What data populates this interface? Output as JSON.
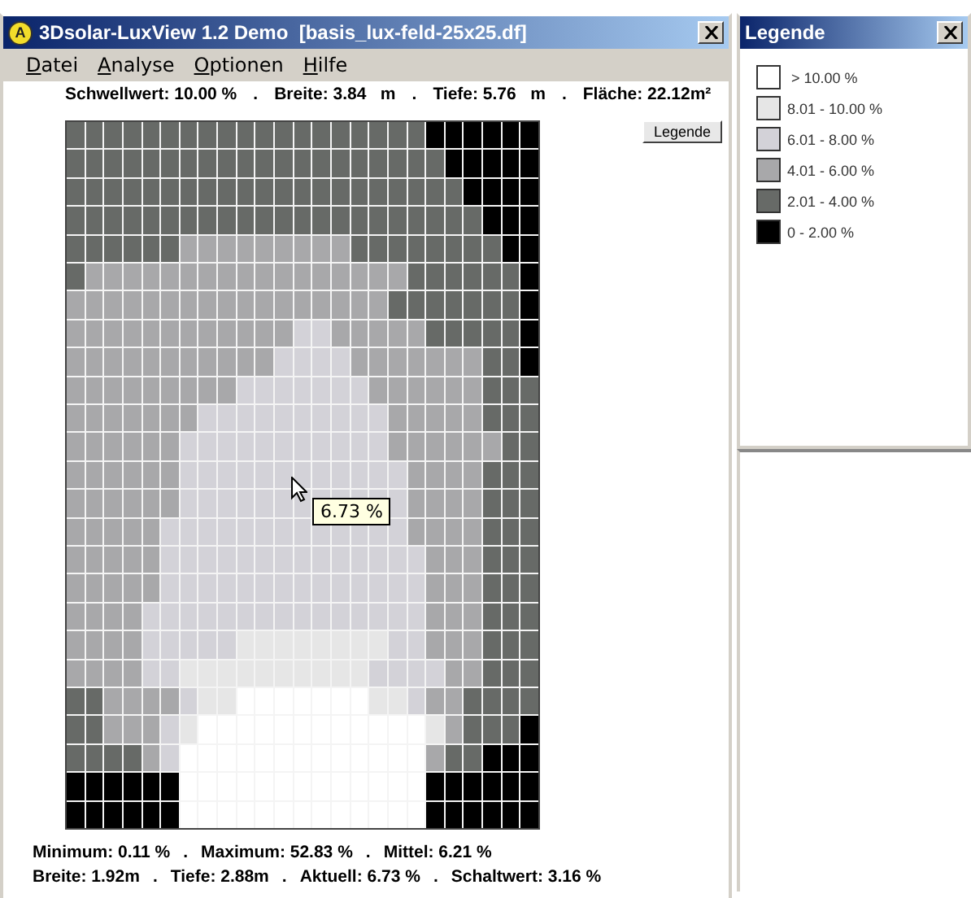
{
  "main_window": {
    "icon_letter": "A",
    "title": "3Dsolar-LuxView 1.2 Demo  [basis_lux-feld-25x25.df]"
  },
  "menu": [
    "Datei",
    "Analyse",
    "Optionen",
    "Hilfe"
  ],
  "header_info": [
    "Schwellwert: 10.00 %",
    "Breite: 3.84   m",
    "Tiefe: 5.76   m",
    "Fläche: 22.12m²"
  ],
  "header_separator": ".",
  "legend_button": "Legende",
  "heatmap": {
    "rows": [
      {
        "cells": [
          {
            "color": "#676a67"
          },
          {
            "color": "#676a67"
          },
          {
            "color": "#676a67"
          },
          {
            "color": "#676a67"
          },
          {
            "color": "#676a67"
          },
          {
            "color": "#676a67"
          },
          {
            "color": "#676a67"
          },
          {
            "color": "#676a67"
          },
          {
            "color": "#676a67"
          },
          {
            "color": "#676a67"
          },
          {
            "color": "#676a67"
          },
          {
            "color": "#676a67"
          },
          {
            "color": "#676a67"
          },
          {
            "color": "#676a67"
          },
          {
            "color": "#676a67"
          },
          {
            "color": "#676a67"
          },
          {
            "color": "#676a67"
          },
          {
            "color": "#676a67"
          },
          {
            "color": "#676a67"
          },
          {
            "color": "#000000"
          },
          {
            "color": "#000000"
          },
          {
            "color": "#000000"
          },
          {
            "color": "#000000"
          },
          {
            "color": "#000000"
          },
          {
            "color": "#000000"
          }
        ]
      },
      {
        "cells": [
          {
            "color": "#676a67"
          },
          {
            "color": "#676a67"
          },
          {
            "color": "#676a67"
          },
          {
            "color": "#676a67"
          },
          {
            "color": "#676a67"
          },
          {
            "color": "#676a67"
          },
          {
            "color": "#676a67"
          },
          {
            "color": "#676a67"
          },
          {
            "color": "#676a67"
          },
          {
            "color": "#676a67"
          },
          {
            "color": "#676a67"
          },
          {
            "color": "#676a67"
          },
          {
            "color": "#676a67"
          },
          {
            "color": "#676a67"
          },
          {
            "color": "#676a67"
          },
          {
            "color": "#676a67"
          },
          {
            "color": "#676a67"
          },
          {
            "color": "#676a67"
          },
          {
            "color": "#676a67"
          },
          {
            "color": "#676a67"
          },
          {
            "color": "#000000"
          },
          {
            "color": "#000000"
          },
          {
            "color": "#000000"
          },
          {
            "color": "#000000"
          },
          {
            "color": "#000000"
          }
        ]
      },
      {
        "cells": [
          {
            "color": "#676a67"
          },
          {
            "color": "#676a67"
          },
          {
            "color": "#676a67"
          },
          {
            "color": "#676a67"
          },
          {
            "color": "#676a67"
          },
          {
            "color": "#676a67"
          },
          {
            "color": "#676a67"
          },
          {
            "color": "#676a67"
          },
          {
            "color": "#676a67"
          },
          {
            "color": "#676a67"
          },
          {
            "color": "#676a67"
          },
          {
            "color": "#676a67"
          },
          {
            "color": "#676a67"
          },
          {
            "color": "#676a67"
          },
          {
            "color": "#676a67"
          },
          {
            "color": "#676a67"
          },
          {
            "color": "#676a67"
          },
          {
            "color": "#676a67"
          },
          {
            "color": "#676a67"
          },
          {
            "color": "#676a67"
          },
          {
            "color": "#676a67"
          },
          {
            "color": "#000000"
          },
          {
            "color": "#000000"
          },
          {
            "color": "#000000"
          },
          {
            "color": "#000000"
          }
        ]
      },
      {
        "cells": [
          {
            "color": "#676a67"
          },
          {
            "color": "#676a67"
          },
          {
            "color": "#676a67"
          },
          {
            "color": "#676a67"
          },
          {
            "color": "#676a67"
          },
          {
            "color": "#676a67"
          },
          {
            "color": "#676a67"
          },
          {
            "color": "#676a67"
          },
          {
            "color": "#676a67"
          },
          {
            "color": "#676a67"
          },
          {
            "color": "#676a67"
          },
          {
            "color": "#676a67"
          },
          {
            "color": "#676a67"
          },
          {
            "color": "#676a67"
          },
          {
            "color": "#676a67"
          },
          {
            "color": "#676a67"
          },
          {
            "color": "#676a67"
          },
          {
            "color": "#676a67"
          },
          {
            "color": "#676a67"
          },
          {
            "color": "#676a67"
          },
          {
            "color": "#676a67"
          },
          {
            "color": "#676a67"
          },
          {
            "color": "#000000"
          },
          {
            "color": "#000000"
          },
          {
            "color": "#000000"
          }
        ]
      },
      {
        "cells": [
          {
            "color": "#676a67"
          },
          {
            "color": "#676a67"
          },
          {
            "color": "#676a67"
          },
          {
            "color": "#676a67"
          },
          {
            "color": "#676a67"
          },
          {
            "color": "#676a67"
          },
          {
            "color": "#a8a8aa"
          },
          {
            "color": "#a8a8aa"
          },
          {
            "color": "#a8a8aa"
          },
          {
            "color": "#a8a8aa"
          },
          {
            "color": "#a8a8aa"
          },
          {
            "color": "#a8a8aa"
          },
          {
            "color": "#a8a8aa"
          },
          {
            "color": "#a8a8aa"
          },
          {
            "color": "#a8a8aa"
          },
          {
            "color": "#676a67"
          },
          {
            "color": "#676a67"
          },
          {
            "color": "#676a67"
          },
          {
            "color": "#676a67"
          },
          {
            "color": "#676a67"
          },
          {
            "color": "#676a67"
          },
          {
            "color": "#676a67"
          },
          {
            "color": "#676a67"
          },
          {
            "color": "#000000"
          },
          {
            "color": "#000000"
          }
        ]
      },
      {
        "cells": [
          {
            "color": "#676a67"
          },
          {
            "color": "#a8a8aa"
          },
          {
            "color": "#a8a8aa"
          },
          {
            "color": "#a8a8aa"
          },
          {
            "color": "#a8a8aa"
          },
          {
            "color": "#a8a8aa"
          },
          {
            "color": "#a8a8aa"
          },
          {
            "color": "#a8a8aa"
          },
          {
            "color": "#a8a8aa"
          },
          {
            "color": "#a8a8aa"
          },
          {
            "color": "#a8a8aa"
          },
          {
            "color": "#a8a8aa"
          },
          {
            "color": "#a8a8aa"
          },
          {
            "color": "#a8a8aa"
          },
          {
            "color": "#a8a8aa"
          },
          {
            "color": "#a8a8aa"
          },
          {
            "color": "#a8a8aa"
          },
          {
            "color": "#a8a8aa"
          },
          {
            "color": "#676a67"
          },
          {
            "color": "#676a67"
          },
          {
            "color": "#676a67"
          },
          {
            "color": "#676a67"
          },
          {
            "color": "#676a67"
          },
          {
            "color": "#676a67"
          },
          {
            "color": "#000000"
          }
        ]
      },
      {
        "cells": [
          {
            "color": "#a8a8aa"
          },
          {
            "color": "#a8a8aa"
          },
          {
            "color": "#a8a8aa"
          },
          {
            "color": "#a8a8aa"
          },
          {
            "color": "#a8a8aa"
          },
          {
            "color": "#a8a8aa"
          },
          {
            "color": "#a8a8aa"
          },
          {
            "color": "#a8a8aa"
          },
          {
            "color": "#a8a8aa"
          },
          {
            "color": "#a8a8aa"
          },
          {
            "color": "#a8a8aa"
          },
          {
            "color": "#a8a8aa"
          },
          {
            "color": "#a8a8aa"
          },
          {
            "color": "#a8a8aa"
          },
          {
            "color": "#a8a8aa"
          },
          {
            "color": "#a8a8aa"
          },
          {
            "color": "#a8a8aa"
          },
          {
            "color": "#676a67"
          },
          {
            "color": "#676a67"
          },
          {
            "color": "#676a67"
          },
          {
            "color": "#676a67"
          },
          {
            "color": "#676a67"
          },
          {
            "color": "#676a67"
          },
          {
            "color": "#676a67"
          },
          {
            "color": "#000000"
          }
        ]
      },
      {
        "cells": [
          {
            "color": "#a8a8aa"
          },
          {
            "color": "#a8a8aa"
          },
          {
            "color": "#a8a8aa"
          },
          {
            "color": "#a8a8aa"
          },
          {
            "color": "#a8a8aa"
          },
          {
            "color": "#a8a8aa"
          },
          {
            "color": "#a8a8aa"
          },
          {
            "color": "#a8a8aa"
          },
          {
            "color": "#a8a8aa"
          },
          {
            "color": "#a8a8aa"
          },
          {
            "color": "#a8a8aa"
          },
          {
            "color": "#a8a8aa"
          },
          {
            "color": "#d3d2d8"
          },
          {
            "color": "#d3d2d8"
          },
          {
            "color": "#a8a8aa"
          },
          {
            "color": "#a8a8aa"
          },
          {
            "color": "#a8a8aa"
          },
          {
            "color": "#a8a8aa"
          },
          {
            "color": "#a8a8aa"
          },
          {
            "color": "#676a67"
          },
          {
            "color": "#676a67"
          },
          {
            "color": "#676a67"
          },
          {
            "color": "#676a67"
          },
          {
            "color": "#676a67"
          },
          {
            "color": "#000000"
          }
        ]
      },
      {
        "cells": [
          {
            "color": "#a8a8aa"
          },
          {
            "color": "#a8a8aa"
          },
          {
            "color": "#a8a8aa"
          },
          {
            "color": "#a8a8aa"
          },
          {
            "color": "#a8a8aa"
          },
          {
            "color": "#a8a8aa"
          },
          {
            "color": "#a8a8aa"
          },
          {
            "color": "#a8a8aa"
          },
          {
            "color": "#a8a8aa"
          },
          {
            "color": "#a8a8aa"
          },
          {
            "color": "#a8a8aa"
          },
          {
            "color": "#d3d2d8"
          },
          {
            "color": "#d3d2d8"
          },
          {
            "color": "#d3d2d8"
          },
          {
            "color": "#d3d2d8"
          },
          {
            "color": "#a8a8aa"
          },
          {
            "color": "#a8a8aa"
          },
          {
            "color": "#a8a8aa"
          },
          {
            "color": "#a8a8aa"
          },
          {
            "color": "#a8a8aa"
          },
          {
            "color": "#a8a8aa"
          },
          {
            "color": "#a8a8aa"
          },
          {
            "color": "#676a67"
          },
          {
            "color": "#676a67"
          },
          {
            "color": "#000000"
          }
        ]
      },
      {
        "cells": [
          {
            "color": "#a8a8aa"
          },
          {
            "color": "#a8a8aa"
          },
          {
            "color": "#a8a8aa"
          },
          {
            "color": "#a8a8aa"
          },
          {
            "color": "#a8a8aa"
          },
          {
            "color": "#a8a8aa"
          },
          {
            "color": "#a8a8aa"
          },
          {
            "color": "#a8a8aa"
          },
          {
            "color": "#a8a8aa"
          },
          {
            "color": "#d3d2d8"
          },
          {
            "color": "#d3d2d8"
          },
          {
            "color": "#d3d2d8"
          },
          {
            "color": "#d3d2d8"
          },
          {
            "color": "#d3d2d8"
          },
          {
            "color": "#d3d2d8"
          },
          {
            "color": "#d3d2d8"
          },
          {
            "color": "#a8a8aa"
          },
          {
            "color": "#a8a8aa"
          },
          {
            "color": "#a8a8aa"
          },
          {
            "color": "#a8a8aa"
          },
          {
            "color": "#a8a8aa"
          },
          {
            "color": "#a8a8aa"
          },
          {
            "color": "#676a67"
          },
          {
            "color": "#676a67"
          },
          {
            "color": "#676a67"
          }
        ]
      },
      {
        "cells": [
          {
            "color": "#a8a8aa"
          },
          {
            "color": "#a8a8aa"
          },
          {
            "color": "#a8a8aa"
          },
          {
            "color": "#a8a8aa"
          },
          {
            "color": "#a8a8aa"
          },
          {
            "color": "#a8a8aa"
          },
          {
            "color": "#a8a8aa"
          },
          {
            "color": "#d3d2d8"
          },
          {
            "color": "#d3d2d8"
          },
          {
            "color": "#d3d2d8"
          },
          {
            "color": "#d3d2d8"
          },
          {
            "color": "#d3d2d8"
          },
          {
            "color": "#d3d2d8"
          },
          {
            "color": "#d3d2d8"
          },
          {
            "color": "#d3d2d8"
          },
          {
            "color": "#d3d2d8"
          },
          {
            "color": "#d3d2d8"
          },
          {
            "color": "#a8a8aa"
          },
          {
            "color": "#a8a8aa"
          },
          {
            "color": "#a8a8aa"
          },
          {
            "color": "#a8a8aa"
          },
          {
            "color": "#a8a8aa"
          },
          {
            "color": "#676a67"
          },
          {
            "color": "#676a67"
          },
          {
            "color": "#676a67"
          }
        ]
      },
      {
        "cells": [
          {
            "color": "#a8a8aa"
          },
          {
            "color": "#a8a8aa"
          },
          {
            "color": "#a8a8aa"
          },
          {
            "color": "#a8a8aa"
          },
          {
            "color": "#a8a8aa"
          },
          {
            "color": "#a8a8aa"
          },
          {
            "color": "#d3d2d8"
          },
          {
            "color": "#d3d2d8"
          },
          {
            "color": "#d3d2d8"
          },
          {
            "color": "#d3d2d8"
          },
          {
            "color": "#d3d2d8"
          },
          {
            "color": "#d3d2d8"
          },
          {
            "color": "#d3d2d8"
          },
          {
            "color": "#d3d2d8"
          },
          {
            "color": "#d3d2d8"
          },
          {
            "color": "#d3d2d8"
          },
          {
            "color": "#d3d2d8"
          },
          {
            "color": "#a8a8aa"
          },
          {
            "color": "#a8a8aa"
          },
          {
            "color": "#a8a8aa"
          },
          {
            "color": "#a8a8aa"
          },
          {
            "color": "#a8a8aa"
          },
          {
            "color": "#a8a8aa"
          },
          {
            "color": "#676a67"
          },
          {
            "color": "#676a67"
          }
        ]
      },
      {
        "cells": [
          {
            "color": "#a8a8aa"
          },
          {
            "color": "#a8a8aa"
          },
          {
            "color": "#a8a8aa"
          },
          {
            "color": "#a8a8aa"
          },
          {
            "color": "#a8a8aa"
          },
          {
            "color": "#a8a8aa"
          },
          {
            "color": "#d3d2d8"
          },
          {
            "color": "#d3d2d8"
          },
          {
            "color": "#d3d2d8"
          },
          {
            "color": "#d3d2d8"
          },
          {
            "color": "#d3d2d8"
          },
          {
            "color": "#d3d2d8"
          },
          {
            "color": "#d3d2d8"
          },
          {
            "color": "#d3d2d8"
          },
          {
            "color": "#d3d2d8"
          },
          {
            "color": "#d3d2d8"
          },
          {
            "color": "#d3d2d8"
          },
          {
            "color": "#d3d2d8"
          },
          {
            "color": "#a8a8aa"
          },
          {
            "color": "#a8a8aa"
          },
          {
            "color": "#a8a8aa"
          },
          {
            "color": "#a8a8aa"
          },
          {
            "color": "#676a67"
          },
          {
            "color": "#676a67"
          },
          {
            "color": "#676a67"
          }
        ]
      },
      {
        "cells": [
          {
            "color": "#a8a8aa"
          },
          {
            "color": "#a8a8aa"
          },
          {
            "color": "#a8a8aa"
          },
          {
            "color": "#a8a8aa"
          },
          {
            "color": "#a8a8aa"
          },
          {
            "color": "#a8a8aa"
          },
          {
            "color": "#d3d2d8"
          },
          {
            "color": "#d3d2d8"
          },
          {
            "color": "#d3d2d8"
          },
          {
            "color": "#d3d2d8"
          },
          {
            "color": "#d3d2d8"
          },
          {
            "color": "#d3d2d8"
          },
          {
            "color": "#d3d2d8"
          },
          {
            "color": "#d3d2d8"
          },
          {
            "color": "#d3d2d8"
          },
          {
            "color": "#d3d2d8"
          },
          {
            "color": "#d3d2d8"
          },
          {
            "color": "#d3d2d8"
          },
          {
            "color": "#a8a8aa"
          },
          {
            "color": "#a8a8aa"
          },
          {
            "color": "#a8a8aa"
          },
          {
            "color": "#a8a8aa"
          },
          {
            "color": "#676a67"
          },
          {
            "color": "#676a67"
          },
          {
            "color": "#676a67"
          }
        ]
      },
      {
        "cells": [
          {
            "color": "#a8a8aa"
          },
          {
            "color": "#a8a8aa"
          },
          {
            "color": "#a8a8aa"
          },
          {
            "color": "#a8a8aa"
          },
          {
            "color": "#a8a8aa"
          },
          {
            "color": "#d3d2d8"
          },
          {
            "color": "#d3d2d8"
          },
          {
            "color": "#d3d2d8"
          },
          {
            "color": "#d3d2d8"
          },
          {
            "color": "#d3d2d8"
          },
          {
            "color": "#d3d2d8"
          },
          {
            "color": "#d3d2d8"
          },
          {
            "color": "#d3d2d8"
          },
          {
            "color": "#d3d2d8"
          },
          {
            "color": "#d3d2d8"
          },
          {
            "color": "#d3d2d8"
          },
          {
            "color": "#d3d2d8"
          },
          {
            "color": "#d3d2d8"
          },
          {
            "color": "#a8a8aa"
          },
          {
            "color": "#a8a8aa"
          },
          {
            "color": "#a8a8aa"
          },
          {
            "color": "#a8a8aa"
          },
          {
            "color": "#676a67"
          },
          {
            "color": "#676a67"
          },
          {
            "color": "#676a67"
          }
        ]
      },
      {
        "cells": [
          {
            "color": "#a8a8aa"
          },
          {
            "color": "#a8a8aa"
          },
          {
            "color": "#a8a8aa"
          },
          {
            "color": "#a8a8aa"
          },
          {
            "color": "#a8a8aa"
          },
          {
            "color": "#d3d2d8"
          },
          {
            "color": "#d3d2d8"
          },
          {
            "color": "#d3d2d8"
          },
          {
            "color": "#d3d2d8"
          },
          {
            "color": "#d3d2d8"
          },
          {
            "color": "#d3d2d8"
          },
          {
            "color": "#d3d2d8"
          },
          {
            "color": "#d3d2d8"
          },
          {
            "color": "#d3d2d8"
          },
          {
            "color": "#d3d2d8"
          },
          {
            "color": "#d3d2d8"
          },
          {
            "color": "#d3d2d8"
          },
          {
            "color": "#d3d2d8"
          },
          {
            "color": "#d3d2d8"
          },
          {
            "color": "#a8a8aa"
          },
          {
            "color": "#a8a8aa"
          },
          {
            "color": "#a8a8aa"
          },
          {
            "color": "#676a67"
          },
          {
            "color": "#676a67"
          },
          {
            "color": "#676a67"
          }
        ]
      },
      {
        "cells": [
          {
            "color": "#a8a8aa"
          },
          {
            "color": "#a8a8aa"
          },
          {
            "color": "#a8a8aa"
          },
          {
            "color": "#a8a8aa"
          },
          {
            "color": "#a8a8aa"
          },
          {
            "color": "#d3d2d8"
          },
          {
            "color": "#d3d2d8"
          },
          {
            "color": "#d3d2d8"
          },
          {
            "color": "#d3d2d8"
          },
          {
            "color": "#d3d2d8"
          },
          {
            "color": "#d3d2d8"
          },
          {
            "color": "#d3d2d8"
          },
          {
            "color": "#d3d2d8"
          },
          {
            "color": "#d3d2d8"
          },
          {
            "color": "#d3d2d8"
          },
          {
            "color": "#d3d2d8"
          },
          {
            "color": "#d3d2d8"
          },
          {
            "color": "#d3d2d8"
          },
          {
            "color": "#d3d2d8"
          },
          {
            "color": "#a8a8aa"
          },
          {
            "color": "#a8a8aa"
          },
          {
            "color": "#a8a8aa"
          },
          {
            "color": "#676a67"
          },
          {
            "color": "#676a67"
          },
          {
            "color": "#676a67"
          }
        ]
      },
      {
        "cells": [
          {
            "color": "#a8a8aa"
          },
          {
            "color": "#a8a8aa"
          },
          {
            "color": "#a8a8aa"
          },
          {
            "color": "#a8a8aa"
          },
          {
            "color": "#d3d2d8"
          },
          {
            "color": "#d3d2d8"
          },
          {
            "color": "#d3d2d8"
          },
          {
            "color": "#d3d2d8"
          },
          {
            "color": "#d3d2d8"
          },
          {
            "color": "#d3d2d8"
          },
          {
            "color": "#d3d2d8"
          },
          {
            "color": "#d3d2d8"
          },
          {
            "color": "#d3d2d8"
          },
          {
            "color": "#d3d2d8"
          },
          {
            "color": "#d3d2d8"
          },
          {
            "color": "#d3d2d8"
          },
          {
            "color": "#d3d2d8"
          },
          {
            "color": "#d3d2d8"
          },
          {
            "color": "#d3d2d8"
          },
          {
            "color": "#a8a8aa"
          },
          {
            "color": "#a8a8aa"
          },
          {
            "color": "#a8a8aa"
          },
          {
            "color": "#676a67"
          },
          {
            "color": "#676a67"
          },
          {
            "color": "#676a67"
          }
        ]
      },
      {
        "cells": [
          {
            "color": "#a8a8aa"
          },
          {
            "color": "#a8a8aa"
          },
          {
            "color": "#a8a8aa"
          },
          {
            "color": "#a8a8aa"
          },
          {
            "color": "#d3d2d8"
          },
          {
            "color": "#d3d2d8"
          },
          {
            "color": "#d3d2d8"
          },
          {
            "color": "#d3d2d8"
          },
          {
            "color": "#d3d2d8"
          },
          {
            "color": "#e6e6e6"
          },
          {
            "color": "#e6e6e6"
          },
          {
            "color": "#e6e6e6"
          },
          {
            "color": "#e6e6e6"
          },
          {
            "color": "#e6e6e6"
          },
          {
            "color": "#e6e6e6"
          },
          {
            "color": "#e6e6e6"
          },
          {
            "color": "#e6e6e6"
          },
          {
            "color": "#d3d2d8"
          },
          {
            "color": "#d3d2d8"
          },
          {
            "color": "#a8a8aa"
          },
          {
            "color": "#a8a8aa"
          },
          {
            "color": "#a8a8aa"
          },
          {
            "color": "#676a67"
          },
          {
            "color": "#676a67"
          },
          {
            "color": "#676a67"
          }
        ]
      },
      {
        "cells": [
          {
            "color": "#a8a8aa"
          },
          {
            "color": "#a8a8aa"
          },
          {
            "color": "#a8a8aa"
          },
          {
            "color": "#a8a8aa"
          },
          {
            "color": "#d3d2d8"
          },
          {
            "color": "#d3d2d8"
          },
          {
            "color": "#e6e6e6"
          },
          {
            "color": "#e6e6e6"
          },
          {
            "color": "#e6e6e6"
          },
          {
            "color": "#e6e6e6"
          },
          {
            "color": "#e6e6e6"
          },
          {
            "color": "#e6e6e6"
          },
          {
            "color": "#e6e6e6"
          },
          {
            "color": "#e6e6e6"
          },
          {
            "color": "#e6e6e6"
          },
          {
            "color": "#e6e6e6"
          },
          {
            "color": "#d3d2d8"
          },
          {
            "color": "#d3d2d8"
          },
          {
            "color": "#d3d2d8"
          },
          {
            "color": "#d3d2d8"
          },
          {
            "color": "#a8a8aa"
          },
          {
            "color": "#a8a8aa"
          },
          {
            "color": "#676a67"
          },
          {
            "color": "#676a67"
          },
          {
            "color": "#676a67"
          }
        ]
      },
      {
        "cells": [
          {
            "color": "#676a67"
          },
          {
            "color": "#676a67"
          },
          {
            "color": "#a8a8aa"
          },
          {
            "color": "#a8a8aa"
          },
          {
            "color": "#a8a8aa"
          },
          {
            "color": "#a8a8aa"
          },
          {
            "color": "#d3d2d8"
          },
          {
            "color": "#e6e6e6"
          },
          {
            "color": "#e6e6e6"
          },
          {
            "color": "#ffffff"
          },
          {
            "color": "#ffffff"
          },
          {
            "color": "#ffffff"
          },
          {
            "color": "#ffffff"
          },
          {
            "color": "#ffffff"
          },
          {
            "color": "#ffffff"
          },
          {
            "color": "#ffffff"
          },
          {
            "color": "#e6e6e6"
          },
          {
            "color": "#e6e6e6"
          },
          {
            "color": "#d3d2d8"
          },
          {
            "color": "#a8a8aa"
          },
          {
            "color": "#a8a8aa"
          },
          {
            "color": "#676a67"
          },
          {
            "color": "#676a67"
          },
          {
            "color": "#676a67"
          },
          {
            "color": "#676a67"
          }
        ]
      },
      {
        "cells": [
          {
            "color": "#676a67"
          },
          {
            "color": "#676a67"
          },
          {
            "color": "#a8a8aa"
          },
          {
            "color": "#a8a8aa"
          },
          {
            "color": "#a8a8aa"
          },
          {
            "color": "#d3d2d8"
          },
          {
            "color": "#e6e6e6"
          },
          {
            "color": "#ffffff"
          },
          {
            "color": "#ffffff"
          },
          {
            "color": "#ffffff"
          },
          {
            "color": "#ffffff"
          },
          {
            "color": "#ffffff"
          },
          {
            "color": "#ffffff"
          },
          {
            "color": "#ffffff"
          },
          {
            "color": "#ffffff"
          },
          {
            "color": "#ffffff"
          },
          {
            "color": "#ffffff"
          },
          {
            "color": "#ffffff"
          },
          {
            "color": "#ffffff"
          },
          {
            "color": "#e6e6e6"
          },
          {
            "color": "#a8a8aa"
          },
          {
            "color": "#676a67"
          },
          {
            "color": "#676a67"
          },
          {
            "color": "#676a67"
          },
          {
            "color": "#000000"
          }
        ]
      },
      {
        "cells": [
          {
            "color": "#676a67"
          },
          {
            "color": "#676a67"
          },
          {
            "color": "#676a67"
          },
          {
            "color": "#676a67"
          },
          {
            "color": "#a8a8aa"
          },
          {
            "color": "#d3d2d8"
          },
          {
            "color": "#ffffff"
          },
          {
            "color": "#ffffff"
          },
          {
            "color": "#ffffff"
          },
          {
            "color": "#ffffff"
          },
          {
            "color": "#ffffff"
          },
          {
            "color": "#ffffff"
          },
          {
            "color": "#ffffff"
          },
          {
            "color": "#ffffff"
          },
          {
            "color": "#ffffff"
          },
          {
            "color": "#ffffff"
          },
          {
            "color": "#ffffff"
          },
          {
            "color": "#ffffff"
          },
          {
            "color": "#ffffff"
          },
          {
            "color": "#a8a8aa"
          },
          {
            "color": "#676a67"
          },
          {
            "color": "#676a67"
          },
          {
            "color": "#000000"
          },
          {
            "color": "#000000"
          },
          {
            "color": "#000000"
          }
        ]
      },
      {
        "cells": [
          {
            "color": "#000000"
          },
          {
            "color": "#000000"
          },
          {
            "color": "#000000"
          },
          {
            "color": "#000000"
          },
          {
            "color": "#000000"
          },
          {
            "color": "#000000"
          },
          {
            "color": "#ffffff"
          },
          {
            "color": "#ffffff"
          },
          {
            "color": "#ffffff"
          },
          {
            "color": "#ffffff"
          },
          {
            "color": "#ffffff"
          },
          {
            "color": "#ffffff"
          },
          {
            "color": "#ffffff"
          },
          {
            "color": "#ffffff"
          },
          {
            "color": "#ffffff"
          },
          {
            "color": "#ffffff"
          },
          {
            "color": "#ffffff"
          },
          {
            "color": "#ffffff"
          },
          {
            "color": "#ffffff"
          },
          {
            "color": "#000000"
          },
          {
            "color": "#000000"
          },
          {
            "color": "#000000"
          },
          {
            "color": "#000000"
          },
          {
            "color": "#000000"
          },
          {
            "color": "#000000"
          }
        ]
      },
      {
        "cells": [
          {
            "color": "#000000"
          },
          {
            "color": "#000000"
          },
          {
            "color": "#000000"
          },
          {
            "color": "#000000"
          },
          {
            "color": "#000000"
          },
          {
            "color": "#000000"
          },
          {
            "color": "#ffffff"
          },
          {
            "color": "#ffffff"
          },
          {
            "color": "#ffffff"
          },
          {
            "color": "#ffffff"
          },
          {
            "color": "#ffffff"
          },
          {
            "color": "#ffffff"
          },
          {
            "color": "#ffffff"
          },
          {
            "color": "#ffffff"
          },
          {
            "color": "#ffffff"
          },
          {
            "color": "#ffffff"
          },
          {
            "color": "#ffffff"
          },
          {
            "color": "#ffffff"
          },
          {
            "color": "#ffffff"
          },
          {
            "color": "#000000"
          },
          {
            "color": "#000000"
          },
          {
            "color": "#000000"
          },
          {
            "color": "#000000"
          },
          {
            "color": "#000000"
          },
          {
            "color": "#000000"
          }
        ]
      }
    ]
  },
  "tooltip": "6.73 %",
  "stats": [
    [
      "Minimum: 0.11 %",
      "Maximum: 52.83 %",
      "Mittel: 6.21 %"
    ],
    [
      "Breite: 1.92m",
      "Tiefe: 2.88m",
      "Aktuell: 6.73 %",
      "Schaltwert: 3.16 %"
    ]
  ],
  "legend_window": {
    "title": "Legende",
    "items": [
      {
        "label": " > 10.00 %",
        "color": "#ffffff"
      },
      {
        "label": "8.01 - 10.00 %",
        "color": "#e6e6e6"
      },
      {
        "label": "6.01 - 8.00 %",
        "color": "#d3d2d8"
      },
      {
        "label": "4.01 - 6.00 %",
        "color": "#a8a8aa"
      },
      {
        "label": "2.01 - 4.00 %",
        "color": "#676a67"
      },
      {
        "label": "0 - 2.00 %",
        "color": "#000000"
      }
    ]
  }
}
